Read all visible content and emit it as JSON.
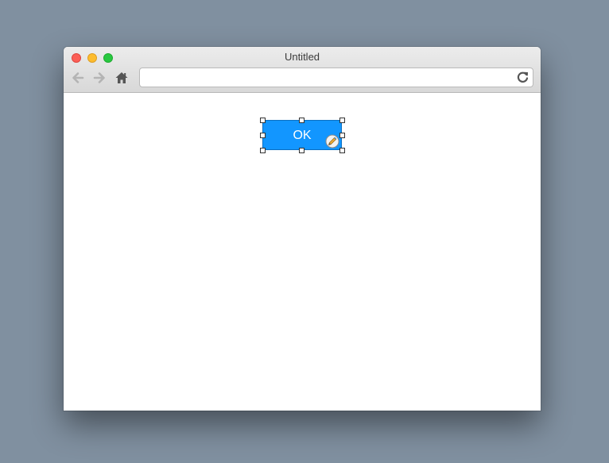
{
  "window": {
    "title": "Untitled"
  },
  "toolbar": {
    "back_icon": "arrow-left-icon",
    "forward_icon": "arrow-right-icon",
    "home_icon": "home-icon",
    "reload_icon": "reload-icon"
  },
  "address_bar": {
    "value": "",
    "placeholder": ""
  },
  "canvas": {
    "ok_button_label": "OK",
    "button_color": "#1296ff",
    "edit_icon": "pencil-edit-icon"
  }
}
